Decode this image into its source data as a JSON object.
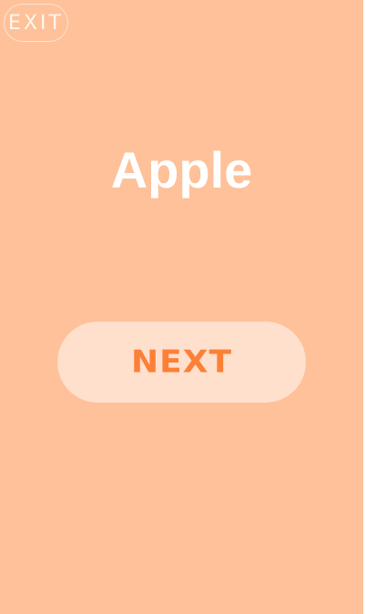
{
  "header": {
    "exit_label": "EXIT"
  },
  "main": {
    "word": "Apple",
    "next_label": "NEXT"
  },
  "colors": {
    "background": "#fec199",
    "next_button_bg": "#fee0cd",
    "next_label": "#fc8037",
    "word": "#ffffff"
  }
}
